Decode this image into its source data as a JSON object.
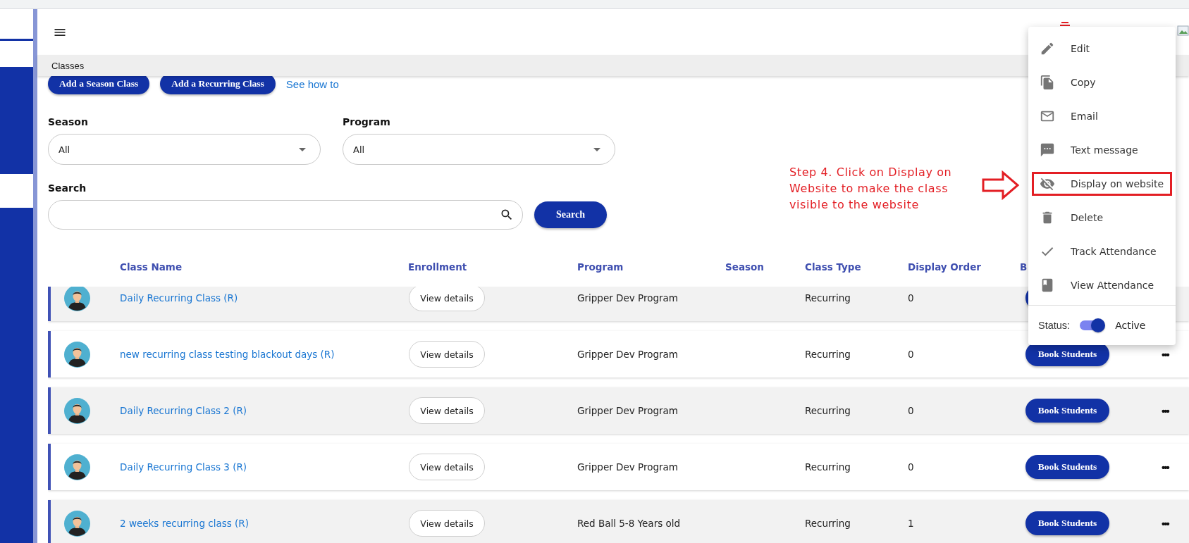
{
  "breadcrumb": "Classes",
  "actions": [
    {
      "label": "Add a Season Class"
    },
    {
      "label": "Add a Recurring Class"
    }
  ],
  "help_link": "See how to",
  "filters": [
    {
      "label": "Season",
      "value": "All"
    },
    {
      "label": "Program",
      "value": "All"
    }
  ],
  "search": {
    "label": "Search",
    "button": "Search"
  },
  "table": {
    "columns": [
      "Class Name",
      "Enrollment",
      "Program",
      "Season",
      "Class Type",
      "Display Order",
      "B"
    ],
    "rows": [
      {
        "name": "Daily Recurring Class (R)",
        "enrollment": "View details",
        "program": "Gripper Dev Program",
        "class_type": "Recurring",
        "display_order": "0"
      },
      {
        "name": "new recurring class testing blackout days (R)",
        "enrollment": "View details",
        "program": "Gripper Dev Program",
        "class_type": "Recurring",
        "display_order": "0",
        "book": "Book Students",
        "more": "•••"
      },
      {
        "name": "Daily Recurring Class 2 (R)",
        "enrollment": "View details",
        "program": "Gripper Dev Program",
        "class_type": "Recurring",
        "display_order": "0",
        "book": "Book Students",
        "more": "•••"
      },
      {
        "name": "Daily Recurring Class 3 (R)",
        "enrollment": "View details",
        "program": "Gripper Dev Program",
        "class_type": "Recurring",
        "display_order": "0",
        "book": "Book Students",
        "more": "•••"
      },
      {
        "name": "2 weeks recurring class (R)",
        "enrollment": "View details",
        "program": "Red Ball 5-8 Years old",
        "class_type": "Recurring",
        "display_order": "1",
        "book": "Book Students",
        "more": "•••"
      }
    ]
  },
  "menu": {
    "items": [
      {
        "kind": "edit",
        "label": "Edit",
        "highlighted": false
      },
      {
        "kind": "copy",
        "label": "Copy",
        "highlighted": false
      },
      {
        "kind": "email",
        "label": "Email",
        "highlighted": false
      },
      {
        "kind": "sms",
        "label": "Text message",
        "highlighted": false
      },
      {
        "kind": "visibility",
        "label": "Display on website",
        "highlighted": true
      },
      {
        "kind": "delete",
        "label": "Delete",
        "highlighted": false
      },
      {
        "kind": "check",
        "label": "Track Attendance",
        "highlighted": false
      },
      {
        "kind": "book",
        "label": "View Attendance",
        "highlighted": false
      }
    ],
    "status": {
      "label": "Status:",
      "on": true,
      "value": "Active"
    }
  },
  "annotation": {
    "lines": [
      "Step 4. Click on Display on",
      "Website to make the class",
      "visible to the website"
    ]
  }
}
